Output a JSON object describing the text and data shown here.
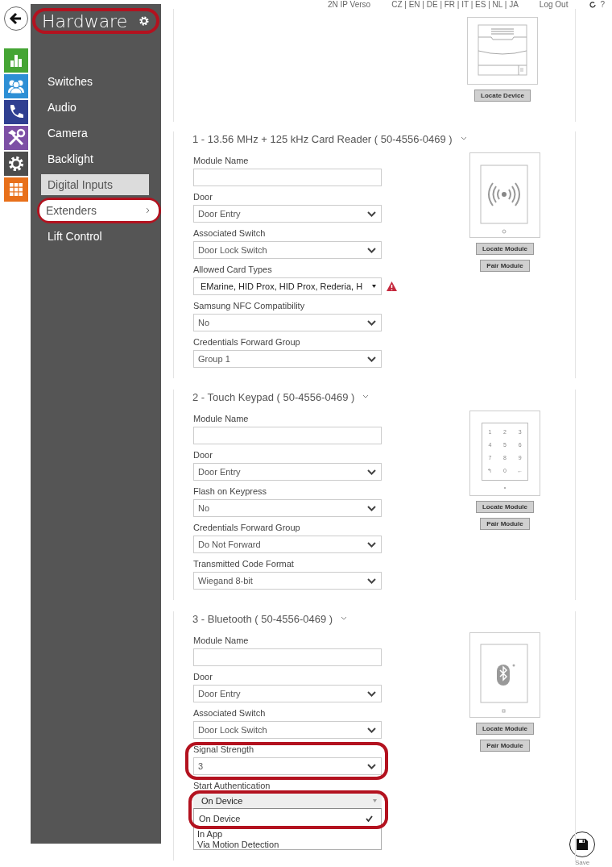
{
  "header": {
    "device": "2N IP Verso",
    "languages": "CZ | EN | DE | FR | IT | ES | NL | JA",
    "logout": "Log Out",
    "help": "?"
  },
  "app_icons": [
    {
      "kind": "status",
      "color": "#45a534"
    },
    {
      "kind": "directory",
      "color": "#2d8fd5"
    },
    {
      "kind": "calls",
      "color": "#2f3f91"
    },
    {
      "kind": "tools",
      "color": "#7d4fa5"
    },
    {
      "kind": "system",
      "color": "#4d4d4d"
    },
    {
      "kind": "apps",
      "color": "#e8701a"
    }
  ],
  "sidebar": {
    "title": "Hardware",
    "highlighted": true,
    "items": [
      {
        "label": "Switches",
        "selected": false,
        "hovered": false,
        "highlighted": false
      },
      {
        "label": "Audio",
        "selected": false,
        "hovered": false,
        "highlighted": false
      },
      {
        "label": "Camera",
        "selected": false,
        "hovered": false,
        "highlighted": false
      },
      {
        "label": "Backlight",
        "selected": false,
        "hovered": false,
        "highlighted": false
      },
      {
        "label": "Digital Inputs",
        "selected": false,
        "hovered": true,
        "highlighted": false
      },
      {
        "label": "Extenders",
        "selected": true,
        "hovered": false,
        "highlighted": true
      },
      {
        "label": "Lift Control",
        "selected": false,
        "hovered": false,
        "highlighted": false
      }
    ]
  },
  "device_panel": {
    "buttons": [
      "Locate Device"
    ]
  },
  "modules": [
    {
      "title": "1 - 13.56 MHz + 125 kHz Card Reader ( 50-4556-0469 )",
      "kind": "card_reader",
      "buttons": [
        "Locate Module",
        "Pair Module"
      ],
      "fields": [
        {
          "label": "Module Name",
          "kind": "text",
          "highlighted": false
        },
        {
          "label": "Door",
          "kind": "select",
          "value": "Door Entry",
          "highlighted": false
        },
        {
          "label": "Associated Switch",
          "kind": "select",
          "value": "Door Lock Switch",
          "highlighted": false
        },
        {
          "label": "Allowed Card Types",
          "kind": "multiselect",
          "value": "EMarine, HID Prox, HID Prox, Rederia, H",
          "warning": true,
          "highlighted": false
        },
        {
          "label": "Samsung NFC Compatibility",
          "kind": "select",
          "value": "No",
          "highlighted": false
        },
        {
          "label": "Credentials Forward Group",
          "kind": "select",
          "value": "Group 1",
          "highlighted": false
        }
      ]
    },
    {
      "title": "2 - Touch Keypad ( 50-4556-0469 )",
      "kind": "keypad",
      "keys": [
        "1",
        "2",
        "3",
        "4",
        "5",
        "6",
        "7",
        "8",
        "9",
        "↰",
        "0",
        "←"
      ],
      "buttons": [
        "Locate Module",
        "Pair Module"
      ],
      "fields": [
        {
          "label": "Module Name",
          "kind": "text",
          "highlighted": false
        },
        {
          "label": "Door",
          "kind": "select",
          "value": "Door Entry",
          "highlighted": false
        },
        {
          "label": "Flash on Keypress",
          "kind": "select",
          "value": "No",
          "highlighted": false
        },
        {
          "label": "Credentials Forward Group",
          "kind": "select",
          "value": "Do Not Forward",
          "highlighted": false
        },
        {
          "label": "Transmitted Code Format",
          "kind": "select",
          "value": "Wiegand 8-bit",
          "highlighted": false
        }
      ]
    },
    {
      "title": "3 - Bluetooth ( 50-4556-0469 )",
      "kind": "bluetooth",
      "buttons": [
        "Locate Module",
        "Pair Module"
      ],
      "fields": [
        {
          "label": "Module Name",
          "kind": "text",
          "highlighted": false
        },
        {
          "label": "Door",
          "kind": "select",
          "value": "Door Entry",
          "highlighted": false
        },
        {
          "label": "Associated Switch",
          "kind": "select",
          "value": "Door Lock Switch",
          "highlighted": false
        },
        {
          "label": "Signal Strength",
          "kind": "select",
          "value": "3",
          "highlighted": true
        },
        {
          "label": "Start Authentication",
          "kind": "open_select",
          "value": "On Device",
          "highlighted": true,
          "options": [
            {
              "label": "On Device",
              "selected": true
            },
            {
              "label": "In App",
              "selected": false
            },
            {
              "label": "Via Motion Detection",
              "selected": false
            }
          ]
        }
      ]
    }
  ],
  "save": {
    "label": "Save"
  }
}
